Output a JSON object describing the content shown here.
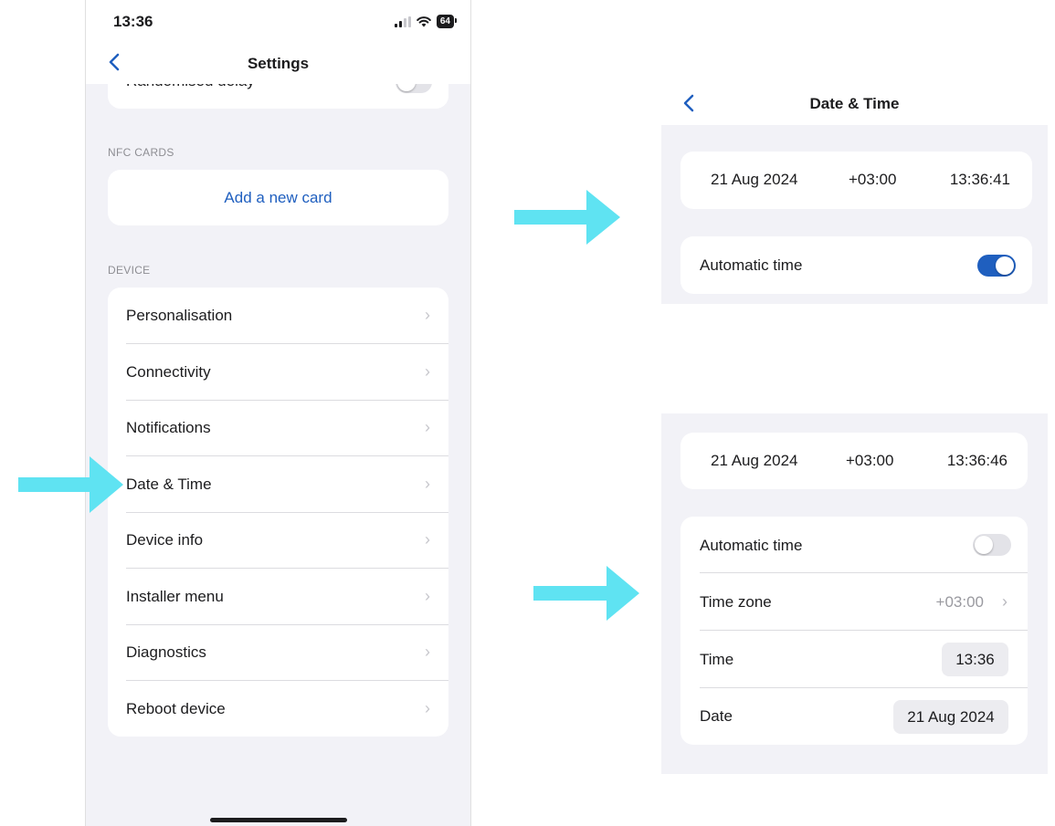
{
  "phone": {
    "status": {
      "time": "13:36",
      "battery": "64"
    },
    "nav": {
      "back_icon": "chevron-left-icon",
      "title": "Settings"
    },
    "partial_row": "Randomised delay",
    "nfc": {
      "section": "NFC CARDS",
      "add_card": "Add a new card"
    },
    "device": {
      "section": "DEVICE",
      "items": [
        {
          "label": "Personalisation"
        },
        {
          "label": "Connectivity"
        },
        {
          "label": "Notifications"
        },
        {
          "label": "Date & Time"
        },
        {
          "label": "Device info"
        },
        {
          "label": "Installer menu"
        },
        {
          "label": "Diagnostics"
        },
        {
          "label": "Reboot device"
        }
      ]
    },
    "chevron": "›"
  },
  "panel_auto": {
    "nav": {
      "back_icon": "chevron-left-icon",
      "title": "Date & Time"
    },
    "date": "21 Aug 2024",
    "offset": "+03:00",
    "time": "13:36:41",
    "automatic_label": "Automatic time",
    "automatic_on": true
  },
  "panel_manual": {
    "date": "21 Aug 2024",
    "offset": "+03:00",
    "time": "13:36:46",
    "automatic_label": "Automatic time",
    "automatic_on": false,
    "timezone_label": "Time zone",
    "timezone_value": "+03:00",
    "time_label": "Time",
    "time_value": "13:36",
    "date_label": "Date",
    "date_value": "21 Aug 2024"
  },
  "colors": {
    "arrow": "#5fe3f2",
    "accent": "#1f5fbf",
    "background": "#f2f2f7"
  }
}
